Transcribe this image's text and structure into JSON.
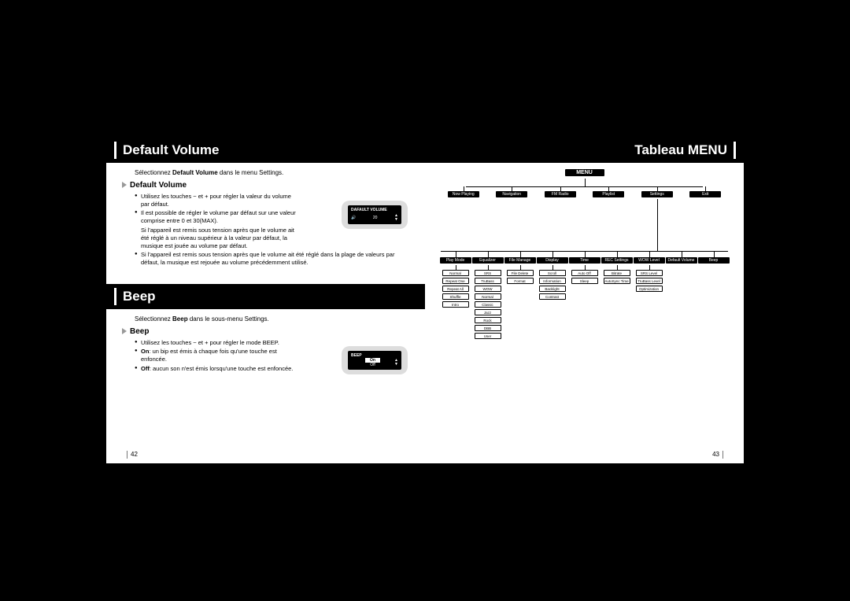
{
  "left": {
    "title1": "Default Volume",
    "intro1_a": "Sélectionnez ",
    "intro1_b": "Default Volume",
    "intro1_c": " dans le menu Settings.",
    "sub1": "Default Volume",
    "b1": "Utilisez les touches  −  et  +  pour régler la valeur du volume par défaut.",
    "b2": "Il est possible de régler le volume par défaut sur une valeur comprise entre 0 et 30(MAX).",
    "b2a": "Si l'appareil est remis sous tension après que le volume ait été réglé à un niveau supérieur à la valeur par défaut, la musique est jouée au volume par défaut.",
    "b3": "Si l'appareil est remis sous tension après que le volume ait été réglé dans la plage de valeurs par défaut, la musique est rejouée au volume précédemment utilisé.",
    "title2": "Beep",
    "intro2_a": "Sélectionnez ",
    "intro2_b": "Beep",
    "intro2_c": " dans le sous-menu Settings.",
    "sub2": "Beep",
    "bb1": "Utilisez les touches  −  et  +  pour régler le mode BEEP.",
    "bb2_a": "On",
    "bb2_b": ": un bip est émis à chaque fois qu'une touche est enfoncée.",
    "bb3_a": "Off",
    "bb3_b": ": aucun son n'est émis lorsqu'une touche est enfoncée.",
    "device1_title": "DAFAULT VOLUME",
    "device1_val": "20",
    "device2_title": "BEEP",
    "device2_on": "On",
    "device2_off": "Off",
    "page_num": "42"
  },
  "right": {
    "title": "Tableau MENU",
    "root": "MENU",
    "row2": [
      "Now Playing",
      "Navigation",
      "FM Radio",
      "Playlist",
      "Settings",
      "Exit"
    ],
    "row3": [
      "Play Mode",
      "Equalizer",
      "File Manage",
      "Display",
      "Time",
      "REC Settings",
      "WOW Level",
      "Default Volume",
      "Beep"
    ],
    "leaves": {
      "0": [
        "Normal",
        "Repeat One",
        "Repeat All",
        "Shuffle",
        "Intro"
      ],
      "1": [
        "SRS",
        "TruBass",
        "WOW",
        "Normal",
        "Classic",
        "Jazz",
        "Rock",
        "DBB",
        "User"
      ],
      "2": [
        "File Delete",
        "Format"
      ],
      "3": [
        "Scroll",
        "Information",
        "Backlight",
        "Contrast"
      ],
      "4": [
        "Auto Off",
        "Sleep"
      ],
      "5": [
        "Bitrate",
        "AutoSync Time"
      ],
      "6": [
        "SRS Level",
        "TruBass Level",
        "Optimization"
      ]
    },
    "page_num": "43"
  }
}
